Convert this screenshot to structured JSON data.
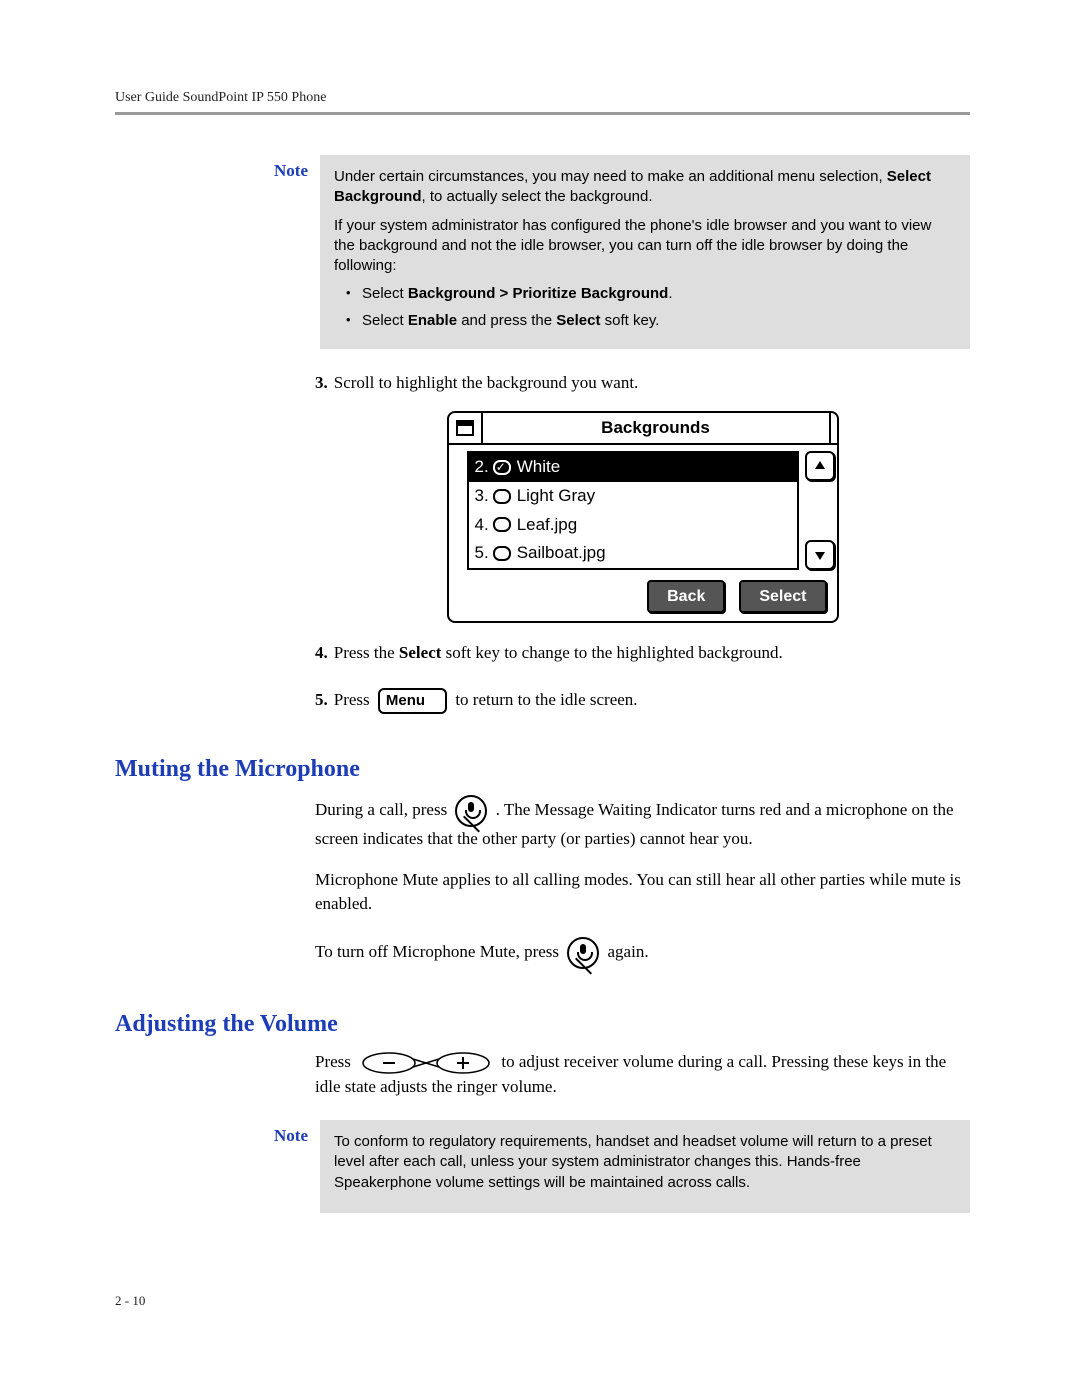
{
  "header": {
    "running": "User Guide SoundPoint IP 550 Phone"
  },
  "note1": {
    "label": "Note",
    "para1_a": "Under certain circumstances, you may need to make an additional menu selection, ",
    "para1_bold": "Select Background",
    "para1_b": ", to actually select the background.",
    "para2": "If your system administrator has configured the phone's idle browser and you want to view the background and not the idle browser, you can turn off the idle browser by doing the following:",
    "bullet1_a": "Select ",
    "bullet1_bold": "Background > Prioritize Background",
    "bullet1_b": ".",
    "bullet2_a": "Select ",
    "bullet2_bold1": "Enable",
    "bullet2_mid": " and press the ",
    "bullet2_bold2": "Select",
    "bullet2_b": " soft key."
  },
  "steps": {
    "s3_num": "3.",
    "s3_text": "Scroll to highlight the background you want.",
    "s4_num": "4.",
    "s4_a": "Press the ",
    "s4_bold": "Select",
    "s4_b": " soft key to change to the highlighted background.",
    "s5_num": "5.",
    "s5_a": "Press ",
    "s5_key": "Menu",
    "s5_b": " to return to the idle screen."
  },
  "screen": {
    "title": "Backgrounds",
    "items": [
      {
        "num": "2.",
        "label": "White",
        "checked": true,
        "selected": true
      },
      {
        "num": "3.",
        "label": "Light Gray",
        "checked": false,
        "selected": false
      },
      {
        "num": "4.",
        "label": "Leaf.jpg",
        "checked": false,
        "selected": false
      },
      {
        "num": "5.",
        "label": "Sailboat.jpg",
        "checked": false,
        "selected": false
      }
    ],
    "softkeys": {
      "back": "Back",
      "select": "Select"
    }
  },
  "heading_mute": "Muting the Microphone",
  "mute": {
    "p1_a": "During a call, press ",
    "p1_b": " . The Message Waiting Indicator turns red and a microphone on the screen indicates that the other party (or parties) cannot hear you.",
    "p2": "Microphone Mute applies to all calling modes. You can still hear all other parties while mute is enabled.",
    "p3_a": "To turn off Microphone Mute, press ",
    "p3_b": " again."
  },
  "heading_vol": "Adjusting the Volume",
  "vol": {
    "p1_a": "Press ",
    "p1_b": " to adjust receiver volume during a call. Pressing these keys in the idle state adjusts the ringer volume."
  },
  "note2": {
    "label": "Note",
    "para1": "To conform to regulatory requirements, handset and headset volume will return to a preset level after each call, unless your system administrator changes this. Hands-free Speakerphone volume settings will be maintained across calls."
  },
  "pagenum": "2 - 10"
}
